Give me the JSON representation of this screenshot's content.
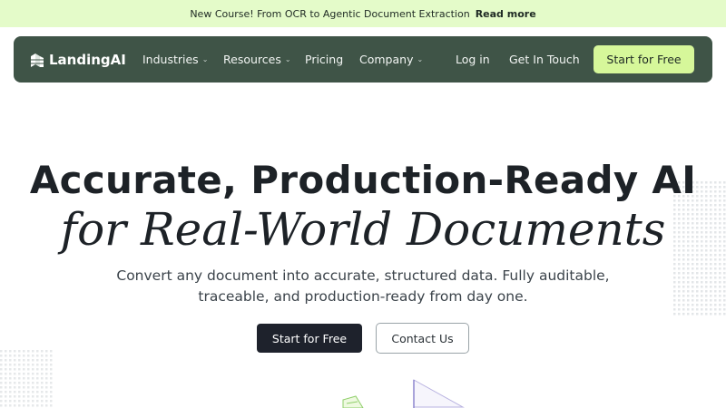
{
  "announcement": {
    "text": "New Course! From OCR to Agentic Document Extraction",
    "link": "Read more"
  },
  "nav": {
    "logo": "LandingAI",
    "items": [
      {
        "label": "Industries",
        "has_dropdown": true
      },
      {
        "label": "Resources",
        "has_dropdown": true
      },
      {
        "label": "Pricing",
        "has_dropdown": false
      },
      {
        "label": "Company",
        "has_dropdown": true
      }
    ],
    "login": "Log in",
    "contact": "Get In Touch",
    "cta": "Start for Free"
  },
  "hero": {
    "title": "Accurate, Production-Ready AI",
    "subtitle": "for Real-World Documents",
    "description": "Convert any document into accurate, structured data. Fully auditable, traceable, and production-ready from day one.",
    "primary_button": "Start for Free",
    "secondary_button": "Contact Us"
  },
  "colors": {
    "announcement_bg": "#e4fbc9",
    "nav_bg": "#3f5447",
    "cta_bg": "#d6f79a",
    "primary_button_bg": "#1e222c",
    "heading_text": "#1d2227"
  }
}
